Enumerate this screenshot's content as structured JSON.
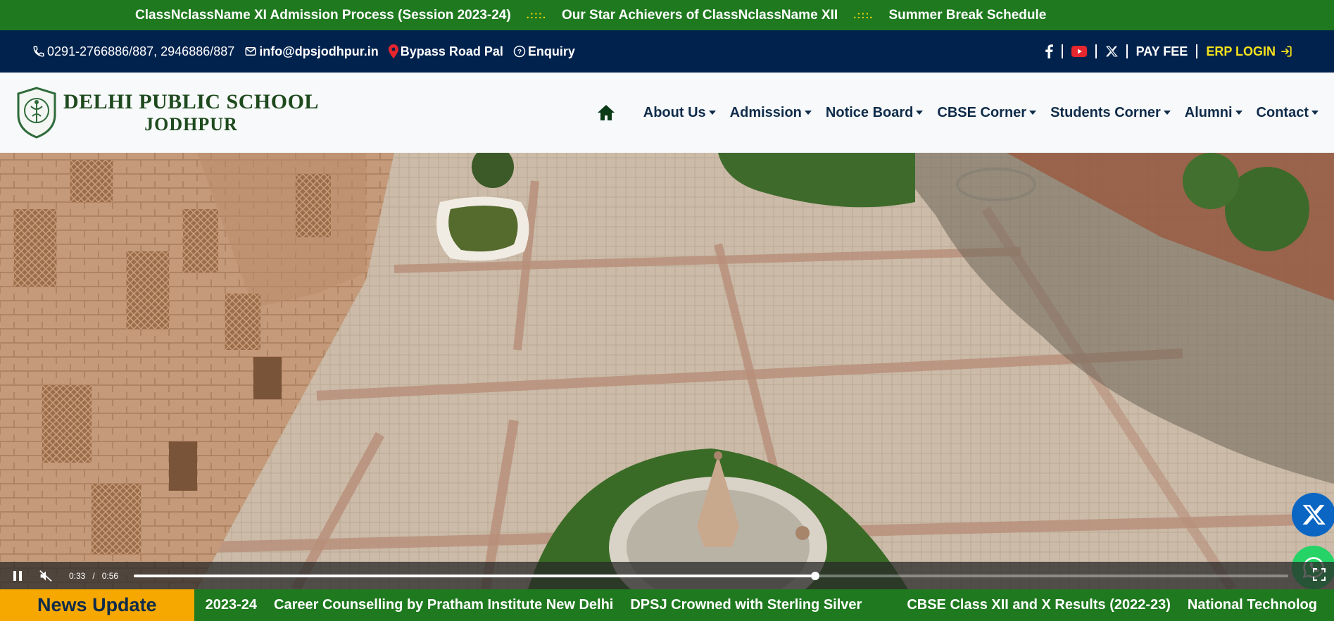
{
  "marquee": {
    "items": [
      "ClassNclassName XI Admission Process (Session 2023-24)",
      "Our Star Achievers of ClassNclassName XII",
      "Summer Break Schedule"
    ],
    "separator": ".:::."
  },
  "contact": {
    "phone": "0291-2766886/887, 2946886/887",
    "email": "info@dpsjodhpur.in",
    "address": "Bypass Road Pal",
    "enquiry": "Enquiry",
    "pay_fee": "PAY FEE",
    "erp_login": "ERP LOGIN",
    "social_icons": [
      "facebook-icon",
      "youtube-icon",
      "x-icon"
    ]
  },
  "header": {
    "school_name": "DELHI PUBLIC SCHOOL",
    "city": "JODHPUR",
    "nav": [
      "About Us",
      "Admission",
      "Notice Board",
      "CBSE Corner",
      "Students Corner",
      "Alumni",
      "Contact"
    ]
  },
  "video": {
    "current_time": "0:33",
    "separator": "/",
    "duration": "0:56",
    "progress_fraction": 0.59,
    "state": "playing",
    "muted": true
  },
  "float_social": [
    "x-icon",
    "whatsapp-icon",
    "facebook-icon"
  ],
  "news": {
    "label": "News Update",
    "items": [
      "2023-24",
      "Career Counselling by Pratham Institute New Delhi",
      "DPSJ Crowned with Sterling Silver",
      "CBSE Class XII and X Results (2022-23)",
      "National Technolog"
    ]
  },
  "colors": {
    "marquee_bg": "#1f7a1f",
    "contact_bg": "#00224d",
    "erp_yellow": "#f6e21a",
    "news_label_bg": "#f6a800",
    "nav_text": "#0f2b4a"
  }
}
